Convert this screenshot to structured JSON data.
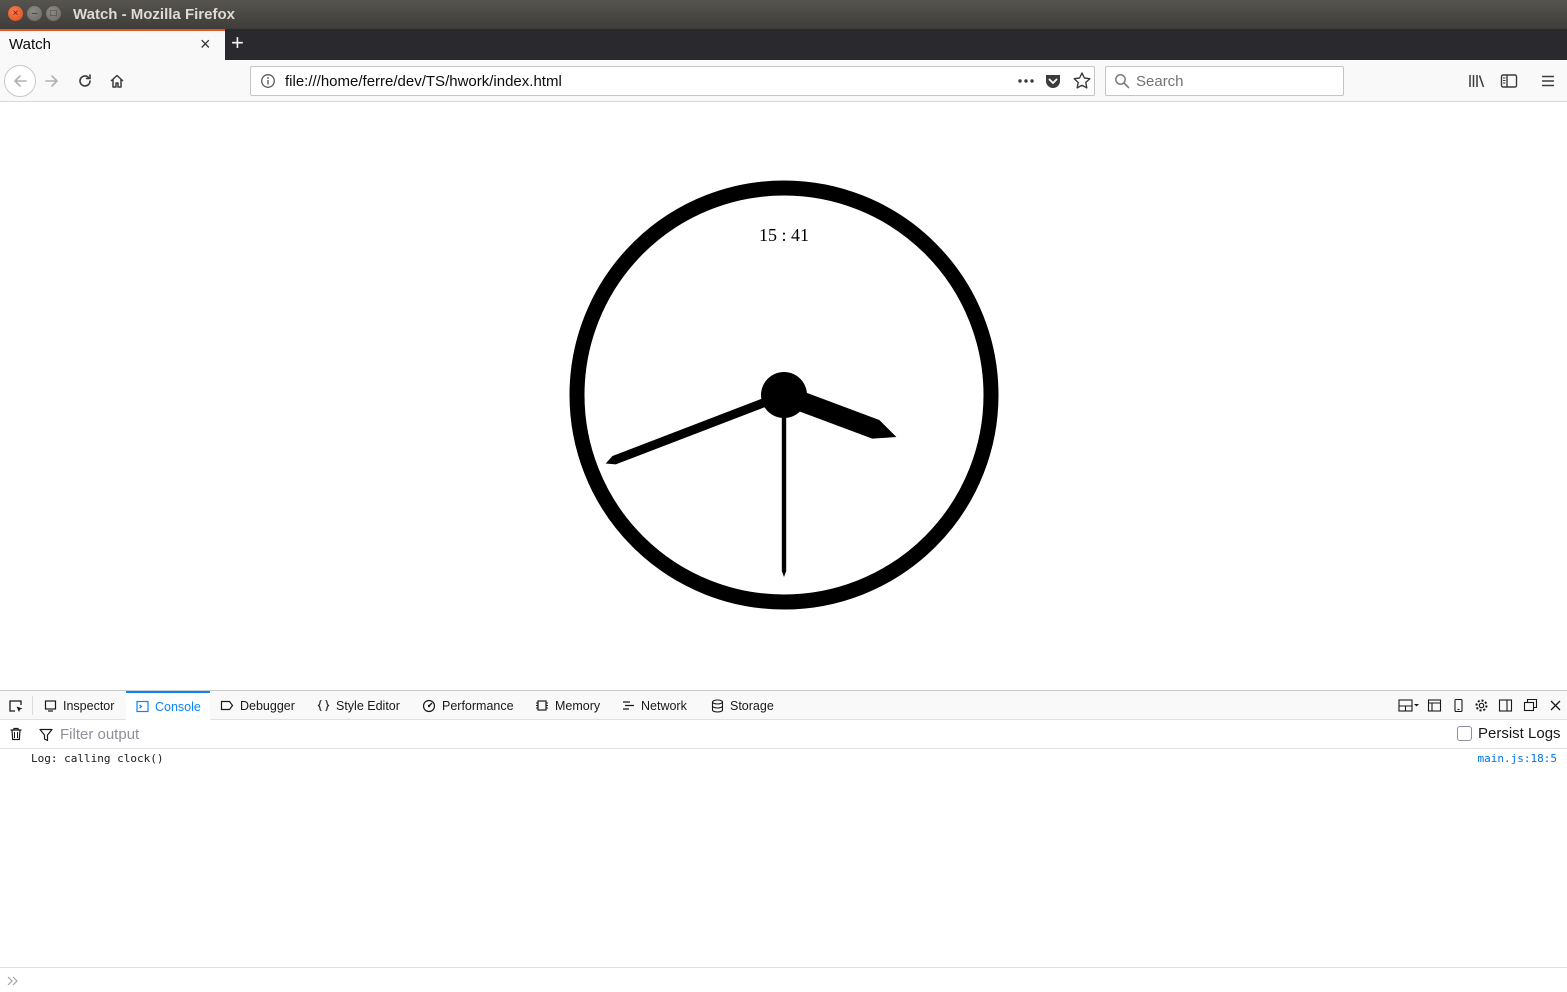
{
  "window": {
    "title": "Watch - Mozilla Firefox",
    "close_glyph": "×",
    "minimize_glyph": "–",
    "maximize_glyph": "□"
  },
  "tabs": {
    "active_title": "Watch",
    "close_glyph": "×",
    "new_tab_glyph": "+"
  },
  "navbar": {
    "url": "file:///home/ferre/dev/TS/hwork/index.html",
    "search_placeholder": "Search"
  },
  "clock": {
    "digital_time": "15 : 41",
    "hours": 15,
    "minutes": 41,
    "seconds": 30
  },
  "devtools": {
    "tabs": [
      "Inspector",
      "Console",
      "Debugger",
      "Style Editor",
      "Performance",
      "Memory",
      "Network",
      "Storage"
    ],
    "active_tab": "Console",
    "filter_placeholder": "Filter output",
    "persist_logs_label": "Persist Logs",
    "log": {
      "message": "Log: calling clock()",
      "source": "main.js:18:5"
    }
  },
  "colors": {
    "accent": "#0a84ff",
    "tab_accent": "#e95420",
    "clock": "#000000"
  },
  "icons": [
    "back-arrow-icon",
    "forward-arrow-icon",
    "reload-icon",
    "home-icon",
    "info-icon",
    "more-dots-icon",
    "pocket-icon",
    "star-icon",
    "search-icon",
    "library-icon",
    "sidebar-icon",
    "hamburger-menu-icon",
    "element-picker-icon",
    "trash-icon",
    "filter-icon",
    "prompt-icon"
  ]
}
